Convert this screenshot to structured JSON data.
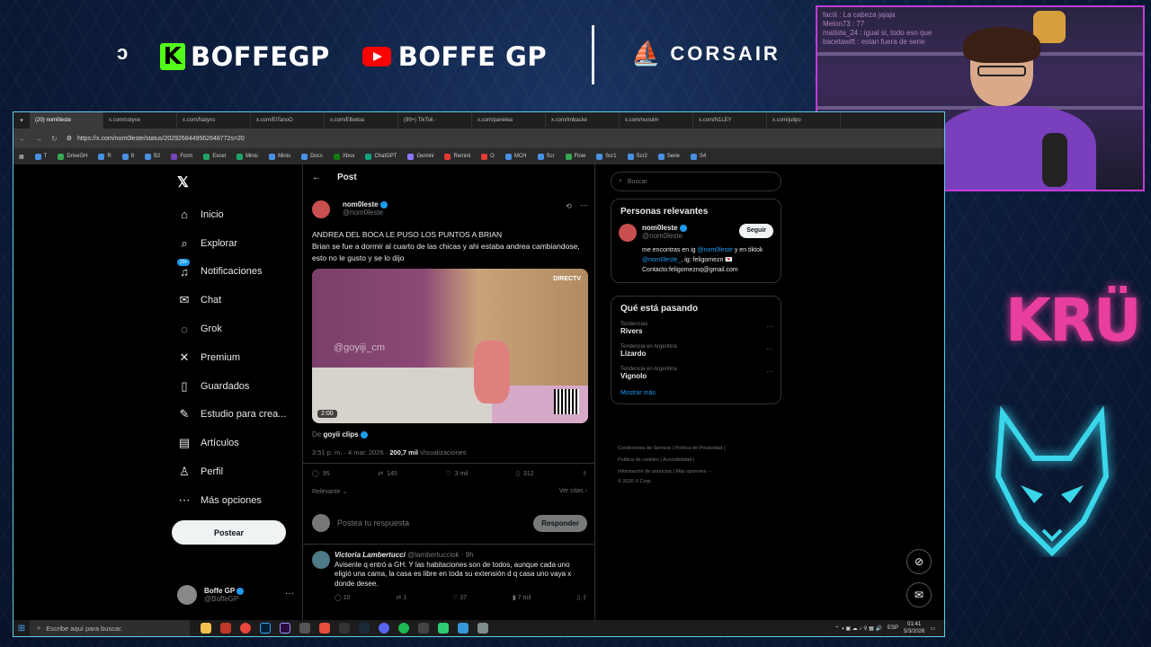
{
  "banner": {
    "partial_text": "ɔ",
    "kick_name": "BOFFEGP",
    "youtube_name": "BOFFE GP",
    "sponsor": "CORSAIR"
  },
  "webcam": {
    "chat_lines": [
      "facili : La cabeza jajaja",
      "Melon73 : 77",
      "matista_24 : igual si, todo eso que",
      "bacetawift : estan fuera de serie"
    ]
  },
  "side_brand": "KRÜ",
  "browser": {
    "tabs": [
      "(20) nom0leste",
      "x.com/cotyve",
      "x.com/Natyns",
      "x.com/ElTanoO",
      "x.com/Elbetoa",
      "(99+) TikTok -",
      "x.com/panelea",
      "x.com/imbacke",
      "x.com/nunuim",
      "x.com/N1LEY",
      "x.com/julipo"
    ],
    "url": "https://x.com/nom0leste/status/2029268449562648772s=20",
    "bookmarks": [
      "T",
      "DriveGH",
      "R",
      "8",
      "B2",
      "Form",
      "Excel",
      "Minis",
      "Minis",
      "Docs",
      "Xbox",
      "ChatGPT",
      "Gemini",
      "Remini",
      "O",
      "MCH",
      "Scr",
      "Flow",
      "Scr1",
      "Scr2",
      "Serie",
      "S4"
    ]
  },
  "sidebar": {
    "items": [
      {
        "label": "Inicio",
        "icon": "home-icon",
        "glyph": "⌂"
      },
      {
        "label": "Explorar",
        "icon": "search-icon",
        "glyph": "⌕"
      },
      {
        "label": "Notificaciones",
        "icon": "bell-icon",
        "glyph": "♫",
        "badge": "20+"
      },
      {
        "label": "Chat",
        "icon": "mail-icon",
        "glyph": "✉"
      },
      {
        "label": "Grok",
        "icon": "grok-icon",
        "glyph": "◌"
      },
      {
        "label": "Premium",
        "icon": "x-icon",
        "glyph": "✕"
      },
      {
        "label": "Guardados",
        "icon": "bookmark-icon",
        "glyph": "▯"
      },
      {
        "label": "Estudio para crea...",
        "icon": "studio-icon",
        "glyph": "✎"
      },
      {
        "label": "Artículos",
        "icon": "article-icon",
        "glyph": "▤"
      },
      {
        "label": "Perfil",
        "icon": "person-icon",
        "glyph": "♙"
      },
      {
        "label": "Más opciones",
        "icon": "more-circle-icon",
        "glyph": "⋯"
      }
    ],
    "post_button": "Postear",
    "account_name": "Boffe GP",
    "account_handle": "@BoffeGP"
  },
  "post": {
    "header": "Post",
    "author_name": "nom0leste",
    "author_handle": "@nom0leste",
    "text_line1": "ANDREA DEL BOCA LE PUSO LOS PUNTOS A BRIAN",
    "text_line2": "Brian se fue a dormir al cuarto de las chicas y ahi estaba andrea cambiandose, esto no le gusto y se lo dijo",
    "video_duration": "2:00",
    "video_watermark": "@goyiji_cm",
    "video_channel": "DIRECTV",
    "from_label": "De",
    "from_name": "goyii clips",
    "time": "3:51 p. m. · 4 mar. 2026 ·",
    "views": "200,7 mil",
    "views_label": "Visualizaciones",
    "replies": "95",
    "reposts": "145",
    "likes": "3 mil",
    "bookmarks": "312",
    "sort_label": "Relevante",
    "quotes_label": "Ver citas",
    "reply_placeholder": "Postea tu respuesta",
    "reply_button": "Responder"
  },
  "comment": {
    "name": "Victoria Lambertucci",
    "handle": "@lambertucciok · 9h",
    "text": "Avisenle q entró a GH. Y las habitaciones son de todos, aunque cada uno eligió una cama, la casa es libre en toda su extensión d q casa uno vaya x donde desee.",
    "replies": "10",
    "reposts": "1",
    "likes": "37",
    "views": "7 mil"
  },
  "right": {
    "search_placeholder": "Buscar",
    "relevant_title": "Personas relevantes",
    "rel_name": "nom0leste",
    "rel_handle": "@nom0leste",
    "follow_label": "Seguir",
    "bio_1": "me encontras en ig",
    "bio_link1": "@nom0leste",
    "bio_2": "y en tiktok",
    "bio_link2": "@nom0leste_",
    "bio_3": "ig: feligomezn 💌",
    "bio_4": "Contacto:feligomeznq@gmail.com",
    "trends_title": "Qué está pasando",
    "trends": [
      {
        "category": "Tendencias",
        "name": "Rivers"
      },
      {
        "category": "Tendencia en Argentina",
        "name": "Lizardo"
      },
      {
        "category": "Tendencia en Argentina",
        "name": "Vignolo"
      }
    ],
    "show_more": "Mostrar más",
    "footer_1": "Condiciones de Servicio  |  Política de Privacidad  |",
    "footer_2": "Política de cookies  |  Accesibilidad  |",
    "footer_3": "Información de anuncios  |  Más opciones ···",
    "footer_4": "© 2026 X Corp."
  },
  "taskbar": {
    "search_placeholder": "Escribe aquí para buscar.",
    "lang": "ESP",
    "time": "01:41",
    "date": "5/3/2026"
  },
  "colors": {
    "accent": "#1d9bf0",
    "frame": "#5ad0e6",
    "kru": "#e83e9f",
    "cam_border": "#c23cd6"
  }
}
